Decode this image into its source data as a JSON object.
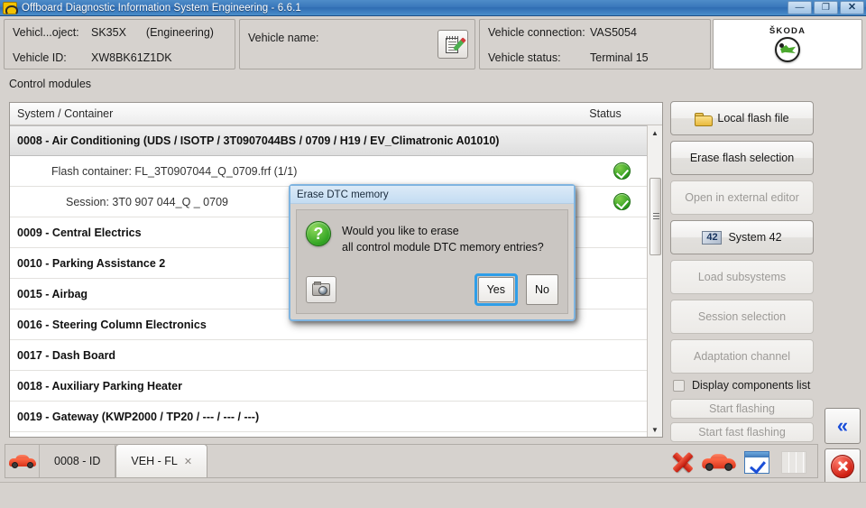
{
  "window": {
    "title": "Offboard Diagnostic Information System Engineering - 6.6.1",
    "app_icon": "engine-icon",
    "minimize_label": "—",
    "maximize_label": "❐",
    "close_label": "✕"
  },
  "header": {
    "vehicle_project_label": "Vehicl...oject:",
    "vehicle_project_value": "SK35X",
    "vehicle_project_mode": "(Engineering)",
    "vehicle_id_label": "Vehicle ID:",
    "vehicle_id_value": "XW8BK61Z1DK",
    "vehicle_name_label": "Vehicle name:",
    "vehicle_name_value": "",
    "notepad_button": "notepad-edit-icon",
    "vehicle_connection_label": "Vehicle connection:",
    "vehicle_connection_value": "VAS5054",
    "vehicle_status_label": "Vehicle status:",
    "vehicle_status_value": "Terminal 15",
    "brand_text": "ŠKODA"
  },
  "main": {
    "section_label": "Control modules",
    "columns": {
      "system": "System / Container",
      "status": "Status"
    },
    "rows": [
      {
        "type": "module",
        "text": "0008 - Air Conditioning  (UDS / ISOTP / 3T0907044BS / 0709 / H19 / EV_Climatronic A01010)",
        "status": "",
        "selected": true
      },
      {
        "type": "sub",
        "text": "Flash container: FL_3T0907044_Q_0709.frf (1/1)",
        "status": "ok",
        "selected": false
      },
      {
        "type": "sub2",
        "text": "Session: 3T0 907 044_Q _ 0709",
        "status": "ok",
        "selected": false
      },
      {
        "type": "module",
        "text": "0009 - Central Electrics",
        "status": "",
        "selected": false
      },
      {
        "type": "module",
        "text": "0010 - Parking Assistance 2",
        "status": "",
        "selected": false
      },
      {
        "type": "module",
        "text": "0015 - Airbag",
        "status": "",
        "selected": false
      },
      {
        "type": "module",
        "text": "0016 - Steering Column Electronics",
        "status": "",
        "selected": false
      },
      {
        "type": "module",
        "text": "0017 - Dash Board",
        "status": "",
        "selected": false
      },
      {
        "type": "module",
        "text": "0018 - Auxiliary Parking Heater",
        "status": "",
        "selected": false
      },
      {
        "type": "module",
        "text": "0019 - Gateway  (KWP2000 / TP20 / --- / --- / ---)",
        "status": "",
        "selected": false
      },
      {
        "type": "empty",
        "text": "",
        "status": "",
        "selected": false
      }
    ],
    "scroll_up": "▲",
    "scroll_down": "▼"
  },
  "side_buttons": [
    {
      "label": "Local flash file",
      "icon": "folder-icon",
      "disabled": false,
      "style": "normal"
    },
    {
      "label": "Erase flash selection",
      "icon": "",
      "disabled": false,
      "style": "normal"
    },
    {
      "label": "Open in external editor",
      "icon": "",
      "disabled": true,
      "style": "normal"
    },
    {
      "label": "System 42",
      "icon": "system-42-icon",
      "icon_text": "42",
      "disabled": false,
      "style": "normal"
    },
    {
      "label": "Load subsystems",
      "icon": "",
      "disabled": true,
      "style": "normal"
    },
    {
      "label": "Session selection",
      "icon": "",
      "disabled": true,
      "style": "normal"
    },
    {
      "label": "Adaptation channel",
      "icon": "",
      "disabled": true,
      "style": "normal"
    }
  ],
  "checkbox": {
    "label": "Display components list",
    "checked": false
  },
  "flash_buttons": [
    {
      "label": "Start flashing",
      "disabled": true
    },
    {
      "label": "Start fast flashing",
      "disabled": true
    }
  ],
  "nav_buttons": [
    {
      "name": "back-button",
      "icon": "double-chevron-left-icon",
      "glyph": "«"
    },
    {
      "name": "cancel-button",
      "icon": "red-x-circle-icon",
      "glyph": "✕"
    }
  ],
  "tabbar": {
    "car_icon": "red-car-icon",
    "tabs": [
      {
        "label": "0008 - ID",
        "active": false,
        "closable": false
      },
      {
        "label": "VEH - FL",
        "active": true,
        "closable": true,
        "close_glyph": "✕"
      }
    ],
    "icons": [
      {
        "name": "red-x-icon",
        "label": ""
      },
      {
        "name": "red-car-icon",
        "label": ""
      },
      {
        "name": "blue-check-icon",
        "label": ""
      },
      {
        "name": "grid-icon",
        "label": ""
      }
    ]
  },
  "dialog": {
    "title": "Erase DTC memory",
    "icon": "green-question-icon",
    "icon_glyph": "?",
    "message_line1": "Would you like to erase",
    "message_line2": "all control module DTC memory entries?",
    "camera_button": "camera-icon",
    "yes_label": "Yes",
    "no_label": "No",
    "focused_button": "Yes"
  },
  "colors": {
    "titlebar": "#3a78bb",
    "panel": "#d6d2ce",
    "accent_blue": "#2f9ee8",
    "status_green": "#2e9b1f",
    "brand_green": "#4ba82e",
    "danger_red": "#c2190c"
  }
}
